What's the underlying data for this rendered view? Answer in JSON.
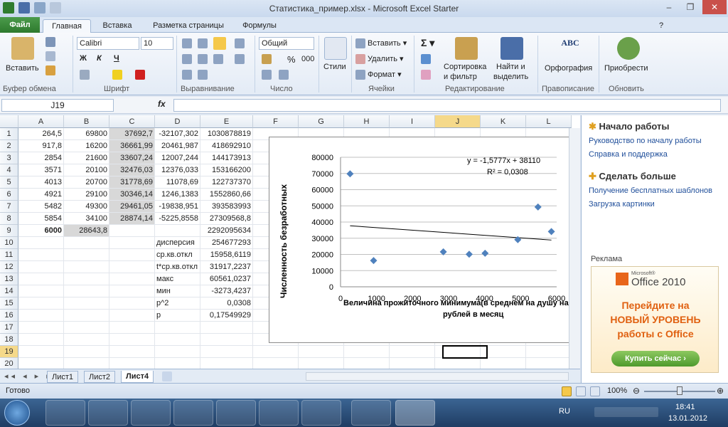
{
  "window": {
    "title": "Статистика_пример.xlsx  -  Microsoft Excel Starter",
    "min_glyph": "–",
    "max_glyph": "❐",
    "close_glyph": "✕"
  },
  "tabs": [
    "Файл",
    "Главная",
    "Вставка",
    "Разметка страницы",
    "Формулы"
  ],
  "ribbon": {
    "paste_label": "Вставить",
    "clipboard_group": "Буфер обмена",
    "font_name": "Calibri",
    "font_size": "10",
    "font_group": "Шрифт",
    "bold": "Ж",
    "italic": "К",
    "underline": "Ч",
    "align_group": "Выравнивание",
    "number_format": "Общий",
    "percent": "%",
    "thousands": "000",
    "number_group": "Число",
    "styles_label": "Стили",
    "insert_label": "Вставить",
    "delete_label": "Удалить",
    "format_label": "Формат",
    "cells_group": "Ячейки",
    "sort_label_1": "Сортировка",
    "sort_label_2": "и фильтр",
    "find_label_1": "Найти и",
    "find_label_2": "выделить",
    "editing_group": "Редактирование",
    "spelling_label": "Орфография",
    "review_group": "Правописание",
    "purchase_label": "Приобрести",
    "update_group": "Обновить",
    "spell_icon_text": "ABC"
  },
  "formula_bar": {
    "name_box": "J19",
    "fx": "fx",
    "value": ""
  },
  "columns": [
    "A",
    "B",
    "C",
    "D",
    "E",
    "F",
    "G",
    "H",
    "I",
    "J",
    "K",
    "L"
  ],
  "rows": [
    [
      "264,5",
      "69800",
      "37692,7",
      "-32107,302",
      "1030878819"
    ],
    [
      "917,8",
      "16200",
      "36661,99",
      "20461,987",
      "418692910"
    ],
    [
      "2854",
      "21600",
      "33607,24",
      "12007,244",
      "144173913"
    ],
    [
      "3571",
      "20100",
      "32476,03",
      "12376,033",
      "153166200"
    ],
    [
      "4013",
      "20700",
      "31778,69",
      "11078,69",
      "122737370"
    ],
    [
      "4921",
      "29100",
      "30346,14",
      "1246,1383",
      "1552860,66"
    ],
    [
      "5482",
      "49300",
      "29461,05",
      "-19838,951",
      "393583993"
    ],
    [
      "5854",
      "34100",
      "28874,14",
      "-5225,8558",
      "27309568,8"
    ],
    [
      "6000",
      "28643,8",
      "",
      "",
      "2292095634"
    ],
    [
      "",
      "",
      "",
      "дисперсия",
      "254677293"
    ],
    [
      "",
      "",
      "",
      "ср.кв.откл",
      "15958,6119"
    ],
    [
      "",
      "",
      "",
      "t*ср.кв.откл",
      "31917,2237"
    ],
    [
      "",
      "",
      "",
      "макс",
      "60561,0237"
    ],
    [
      "",
      "",
      "",
      "мин",
      "-3273,4237"
    ],
    [
      "",
      "",
      "",
      "p^2",
      "0,0308"
    ],
    [
      "",
      "",
      "",
      "p",
      "0,17549929"
    ],
    [
      "",
      "",
      "",
      "",
      ""
    ],
    [
      "",
      "",
      "",
      "",
      ""
    ],
    [
      "",
      "",
      "",
      "",
      ""
    ],
    [
      "",
      "",
      "",
      "",
      ""
    ]
  ],
  "row_numbers": [
    "1",
    "2",
    "3",
    "4",
    "5",
    "6",
    "7",
    "8",
    "9",
    "10",
    "11",
    "12",
    "13",
    "14",
    "15",
    "16",
    "17",
    "18",
    "19",
    "20"
  ],
  "chart_data": {
    "type": "scatter",
    "series": [
      {
        "values": [
          [
            264.5,
            69800
          ],
          [
            917.8,
            16200
          ],
          [
            2854,
            21600
          ],
          [
            3571,
            20100
          ],
          [
            4013,
            20700
          ],
          [
            4921,
            29100
          ],
          [
            5482,
            49300
          ],
          [
            5854,
            34100
          ]
        ]
      }
    ],
    "trendline": {
      "equation": "y = -1,5777x + 38110",
      "r2": "R² = 0,0308",
      "x": [
        264.5,
        5854
      ],
      "y": [
        37693,
        28874
      ]
    },
    "ylabel": "Численность безработных",
    "xlabel": "Величина прожиточного  минимума(в среднем на душу нас",
    "xlabel2": "рублей в месяц",
    "xlim": [
      0,
      6000
    ],
    "ylim": [
      0,
      80000
    ],
    "xticks": [
      "0",
      "1000",
      "2000",
      "3000",
      "4000",
      "5000",
      "6000"
    ],
    "yticks": [
      "0",
      "10000",
      "20000",
      "30000",
      "40000",
      "50000",
      "60000",
      "70000",
      "80000"
    ],
    "marker_color": "#4f81bd",
    "grid": true
  },
  "sheet_tabs": [
    "Лист1",
    "Лист2",
    "Лист4"
  ],
  "taskpane": {
    "head1": "Начало работы",
    "link1": "Руководство по началу работы",
    "link2": "Справка и поддержка",
    "head2": "Сделать больше",
    "link3": "Получение бесплатных шаблонов",
    "link4": "Загрузка картинки",
    "ad_label": "Реклама",
    "ad_brand_small": "Microsoft®",
    "ad_brand": "Office 2010",
    "ad_line1": "Перейдите на",
    "ad_line2": "НОВЫЙ УРОВЕНЬ",
    "ad_line3": "работы с Office",
    "ad_button": "Купить сейчас ›"
  },
  "status": {
    "ready": "Готово",
    "zoom": "100%"
  },
  "taskbar": {
    "lang": "RU",
    "time": "18:41",
    "date": "13.01.2012"
  }
}
